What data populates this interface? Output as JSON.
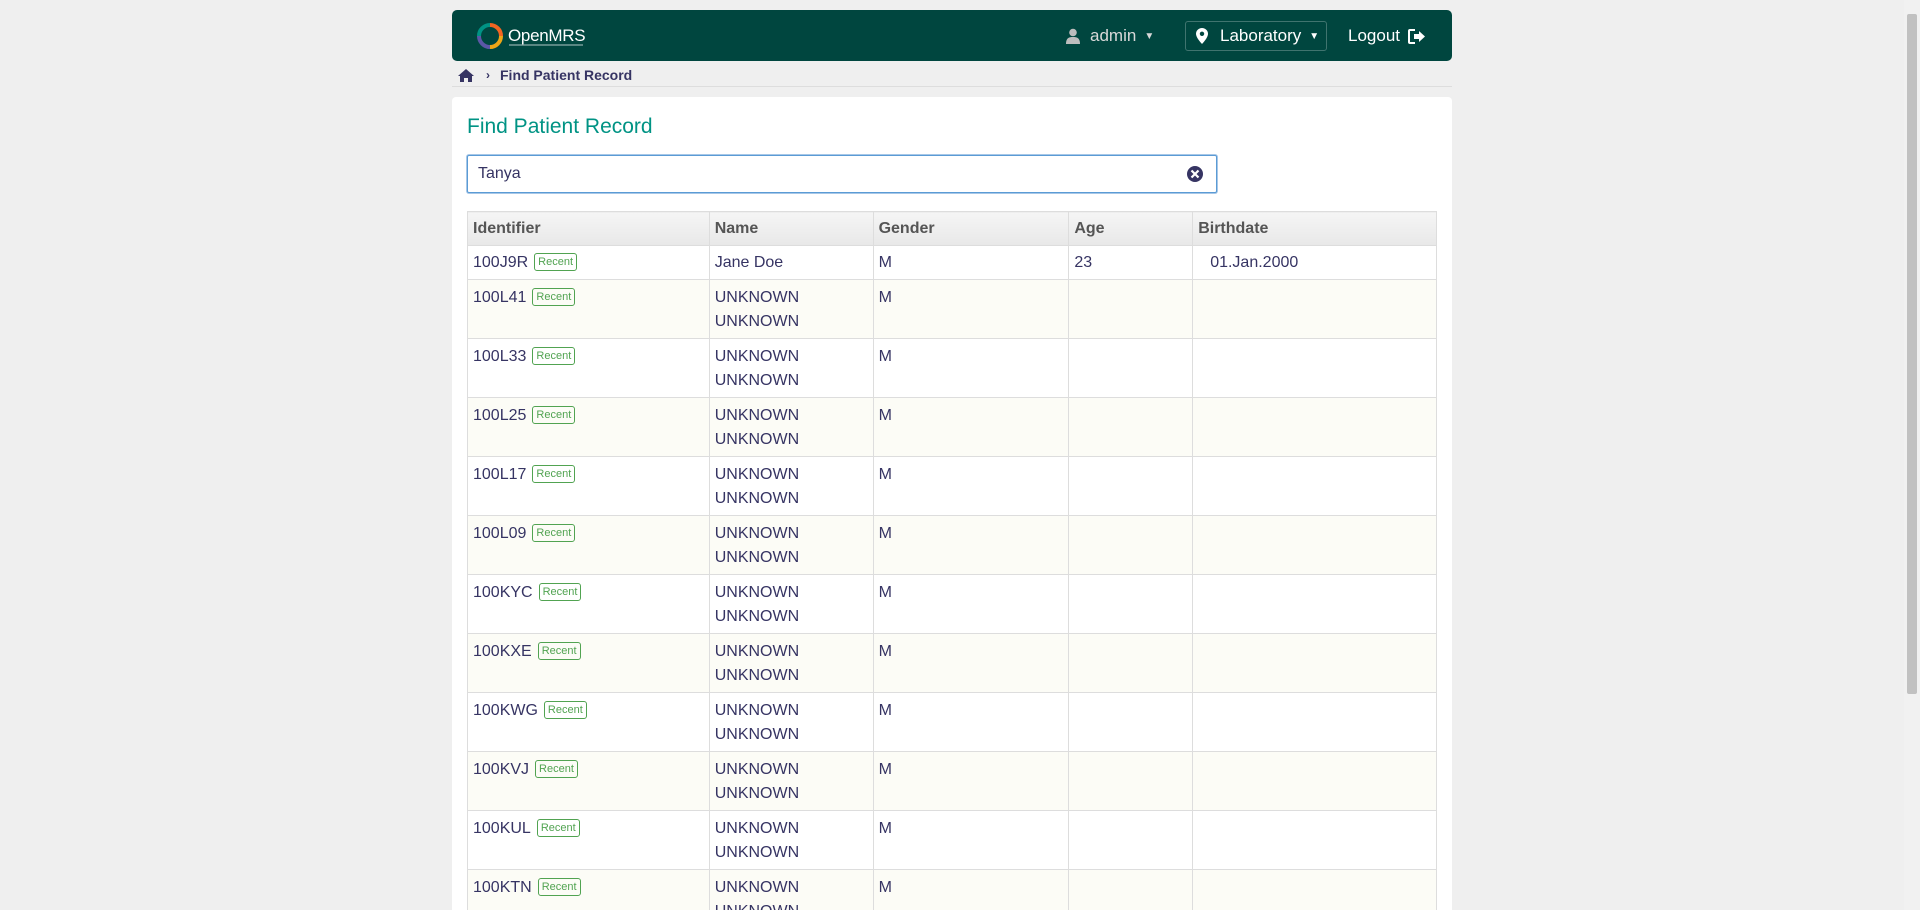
{
  "header": {
    "logo_text": "OpenMRS",
    "user": "admin",
    "location": "Laboratory",
    "logout": "Logout"
  },
  "breadcrumb": {
    "current": "Find Patient Record"
  },
  "main": {
    "title": "Find Patient Record",
    "search": {
      "value": "Tanya",
      "placeholder": ""
    },
    "table": {
      "columns": [
        "Identifier",
        "Name",
        "Gender",
        "Age",
        "Birthdate"
      ],
      "badge_label": "Recent",
      "rows": [
        {
          "identifier": "100J9R",
          "given": "Jane Doe",
          "family": "",
          "gender": "M",
          "age": "23",
          "birthdate": "01.Jan.2000"
        },
        {
          "identifier": "100L41",
          "given": "UNKNOWN",
          "family": "UNKNOWN",
          "gender": "M",
          "age": "",
          "birthdate": ""
        },
        {
          "identifier": "100L33",
          "given": "UNKNOWN",
          "family": "UNKNOWN",
          "gender": "M",
          "age": "",
          "birthdate": ""
        },
        {
          "identifier": "100L25",
          "given": "UNKNOWN",
          "family": "UNKNOWN",
          "gender": "M",
          "age": "",
          "birthdate": ""
        },
        {
          "identifier": "100L17",
          "given": "UNKNOWN",
          "family": "UNKNOWN",
          "gender": "M",
          "age": "",
          "birthdate": ""
        },
        {
          "identifier": "100L09",
          "given": "UNKNOWN",
          "family": "UNKNOWN",
          "gender": "M",
          "age": "",
          "birthdate": ""
        },
        {
          "identifier": "100KYC",
          "given": "UNKNOWN",
          "family": "UNKNOWN",
          "gender": "M",
          "age": "",
          "birthdate": ""
        },
        {
          "identifier": "100KXE",
          "given": "UNKNOWN",
          "family": "UNKNOWN",
          "gender": "M",
          "age": "",
          "birthdate": ""
        },
        {
          "identifier": "100KWG",
          "given": "UNKNOWN",
          "family": "UNKNOWN",
          "gender": "M",
          "age": "",
          "birthdate": ""
        },
        {
          "identifier": "100KVJ",
          "given": "UNKNOWN",
          "family": "UNKNOWN",
          "gender": "M",
          "age": "",
          "birthdate": ""
        },
        {
          "identifier": "100KUL",
          "given": "UNKNOWN",
          "family": "UNKNOWN",
          "gender": "M",
          "age": "",
          "birthdate": ""
        },
        {
          "identifier": "100KTN",
          "given": "UNKNOWN",
          "family": "UNKNOWN",
          "gender": "M",
          "age": "",
          "birthdate": ""
        }
      ]
    }
  },
  "colors": {
    "header_bg": "#00463f",
    "title": "#009384",
    "badge": "#51a351",
    "text": "#363463"
  },
  "icons": {
    "user": "user-icon",
    "location": "map-marker-icon",
    "logout": "sign-out-icon",
    "home": "home-icon",
    "clear": "close-circle-icon"
  }
}
